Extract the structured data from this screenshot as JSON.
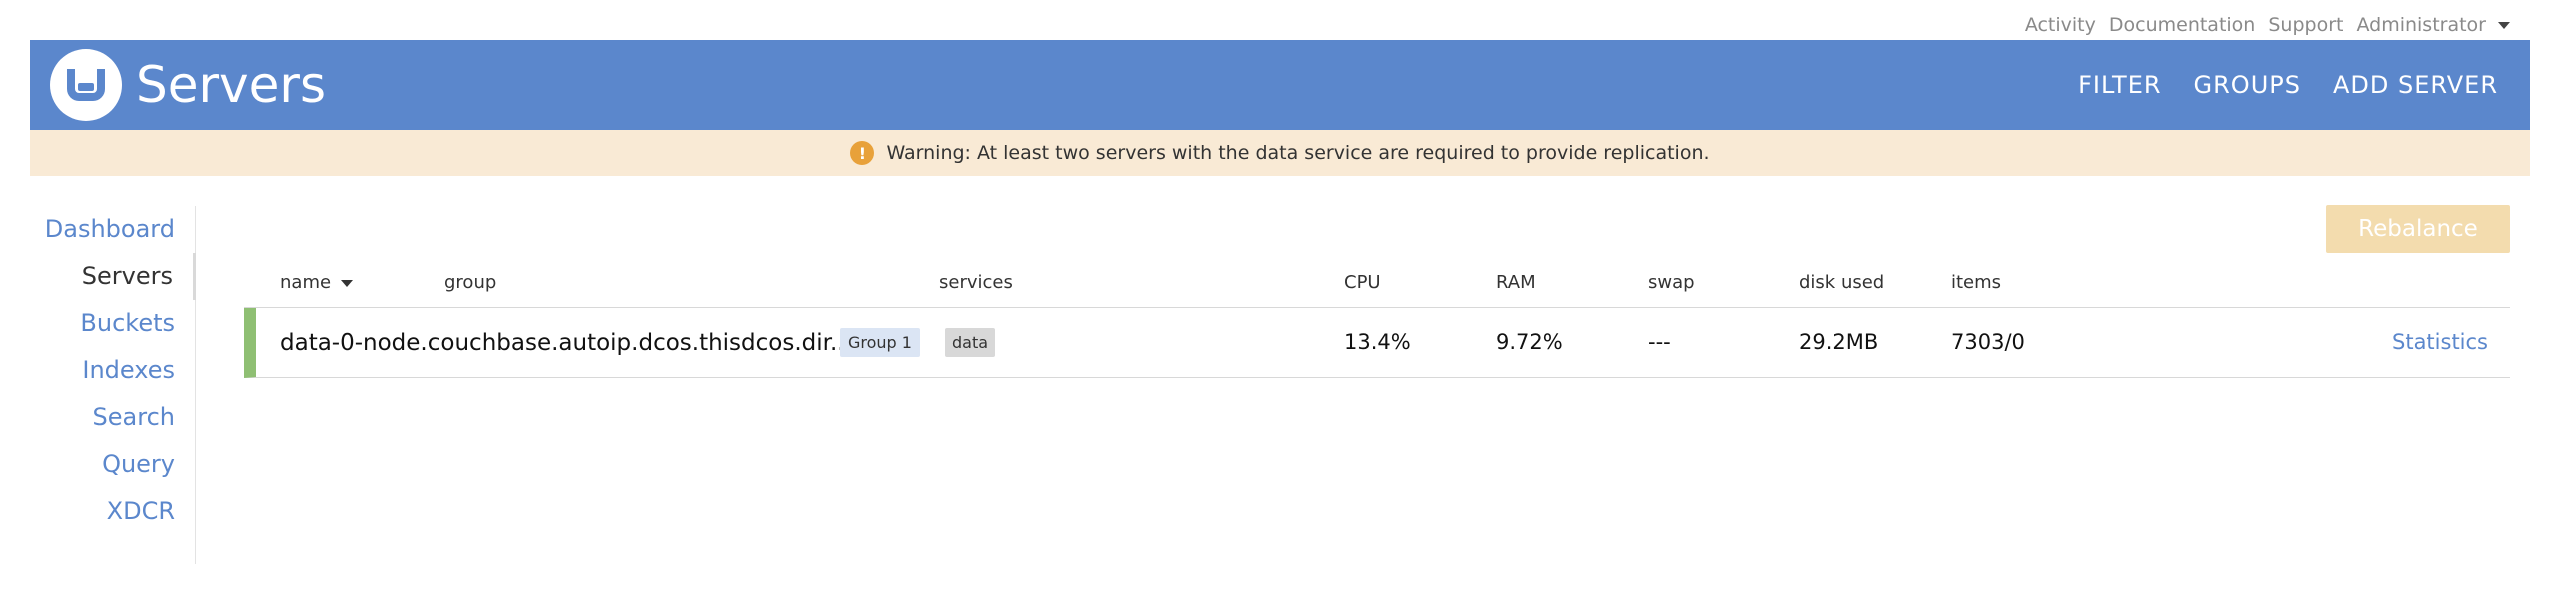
{
  "top_links": {
    "activity": "Activity",
    "documentation": "Documentation",
    "support": "Support",
    "user": "Administrator"
  },
  "header": {
    "title": "Servers",
    "actions": {
      "filter": "FILTER",
      "groups": "GROUPS",
      "add_server": "ADD SERVER"
    }
  },
  "warning": {
    "icon": "!",
    "text": "Warning: At least two servers with the data service are required to provide replication."
  },
  "sidebar": {
    "items": [
      {
        "label": "Dashboard"
      },
      {
        "label": "Servers"
      },
      {
        "label": "Buckets"
      },
      {
        "label": "Indexes"
      },
      {
        "label": "Search"
      },
      {
        "label": "Query"
      },
      {
        "label": "XDCR"
      }
    ],
    "active": "Servers"
  },
  "actions": {
    "rebalance": "Rebalance"
  },
  "table": {
    "columns": {
      "name": "name",
      "group": "group",
      "services": "services",
      "cpu": "CPU",
      "ram": "RAM",
      "swap": "swap",
      "disk_used": "disk used",
      "items": "items"
    },
    "rows": [
      {
        "name": "data-0-node.couchbase.autoip.dcos.thisdcos.dir...",
        "group": "Group 1",
        "service": "data",
        "cpu": "13.4%",
        "ram": "9.72%",
        "swap": "---",
        "disk_used": "29.2MB",
        "items": "7303/0",
        "link": "Statistics",
        "status_color": "#8fbf73"
      }
    ]
  },
  "colors": {
    "accent": "#5b87cc",
    "warning_bg": "#f9ead5",
    "warning_icon": "#e8a13a",
    "rebalance_disabled": "#f3dcae"
  }
}
